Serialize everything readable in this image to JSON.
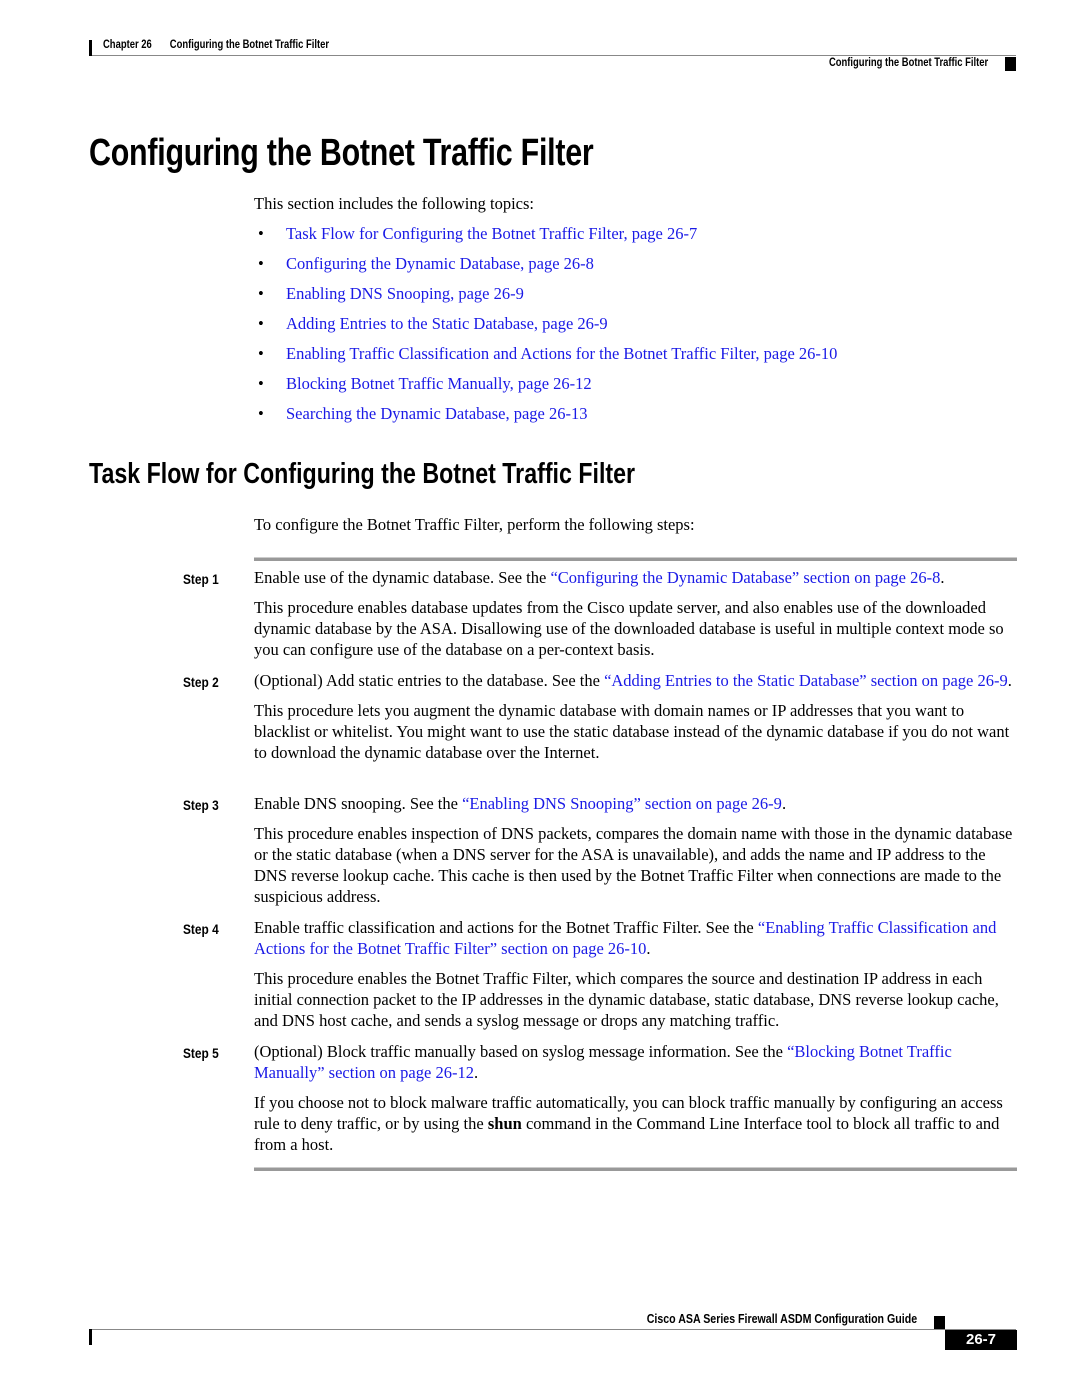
{
  "header": {
    "chapter_label": "Chapter 26",
    "chapter_title": "Configuring the Botnet Traffic Filter",
    "running_title": "Configuring the Botnet Traffic Filter"
  },
  "main_title": "Configuring the Botnet Traffic Filter",
  "intro": "This section includes the following topics:",
  "bullet_glyph": "•",
  "topics": [
    {
      "label": "Task Flow for Configuring the Botnet Traffic Filter, page 26-7"
    },
    {
      "label": "Configuring the Dynamic Database, page 26-8"
    },
    {
      "label": "Enabling DNS Snooping, page 26-9"
    },
    {
      "label": "Adding Entries to the Static Database, page 26-9"
    },
    {
      "label": "Enabling Traffic Classification and Actions for the Botnet Traffic Filter, page 26-10"
    },
    {
      "label": "Blocking Botnet Traffic Manually, page 26-12"
    },
    {
      "label": "Searching the Dynamic Database, page 26-13"
    }
  ],
  "section": {
    "title": "Task Flow for Configuring the Botnet Traffic Filter",
    "intro": "To configure the Botnet Traffic Filter, perform the following steps:",
    "steps": [
      {
        "label": "Step 1",
        "lead": "Enable use of the dynamic database. See the ",
        "link": "“Configuring the Dynamic Database” section on page 26-8",
        "tail": ".",
        "detail": "This procedure enables database updates from the Cisco update server, and also enables use of the downloaded dynamic database by the ASA. Disallowing use of the downloaded database is useful in multiple context mode so you can configure use of the database on a per-context basis."
      },
      {
        "label": "Step 2",
        "lead": "(Optional) Add static entries to the database. See the ",
        "link": "“Adding Entries to the Static Database” section on page 26-9",
        "tail": ".",
        "detail": "This procedure lets you augment the dynamic database with domain names or IP addresses that you want to blacklist or whitelist. You might want to use the static database instead of the dynamic database if you do not want to download the dynamic database over the Internet."
      },
      {
        "label": "Step 3",
        "lead": "Enable DNS snooping. See the ",
        "link": "“Enabling DNS Snooping” section on page 26-9",
        "tail": ".",
        "detail": "This procedure enables inspection of DNS packets, compares the domain name with those in the dynamic database or the static database (when a DNS server for the ASA is unavailable), and adds the name and IP address to the DNS reverse lookup cache. This cache is then used by the Botnet Traffic Filter when connections are made to the suspicious address."
      },
      {
        "label": "Step 4",
        "lead": "Enable traffic classification and actions for the Botnet Traffic Filter. See the ",
        "link": "“Enabling Traffic Classification and Actions for the Botnet Traffic Filter” section on page 26-10",
        "tail": ".",
        "detail": "This procedure enables the Botnet Traffic Filter, which compares the source and destination IP address in each initial connection packet to the IP addresses in the dynamic database, static database, DNS reverse lookup cache, and DNS host cache, and sends a syslog message or drops any matching traffic."
      },
      {
        "label": "Step 5",
        "lead": "(Optional) Block traffic manually based on syslog message information. See the ",
        "link": "“Blocking Botnet Traffic Manually” section on page 26-12",
        "tail": ".",
        "detail_pre": "If you choose not to block malware traffic automatically, you can block traffic manually by configuring an access rule to deny traffic, or by using the ",
        "detail_bold": "shun",
        "detail_post": " command in the Command Line Interface tool to block all traffic to and from a host."
      }
    ]
  },
  "footer": {
    "guide_title": "Cisco ASA Series Firewall ASDM Configuration Guide",
    "page_number": "26-7"
  },
  "colors": {
    "link": "#1a1ae6",
    "rule": "#999999",
    "text": "#000000"
  }
}
